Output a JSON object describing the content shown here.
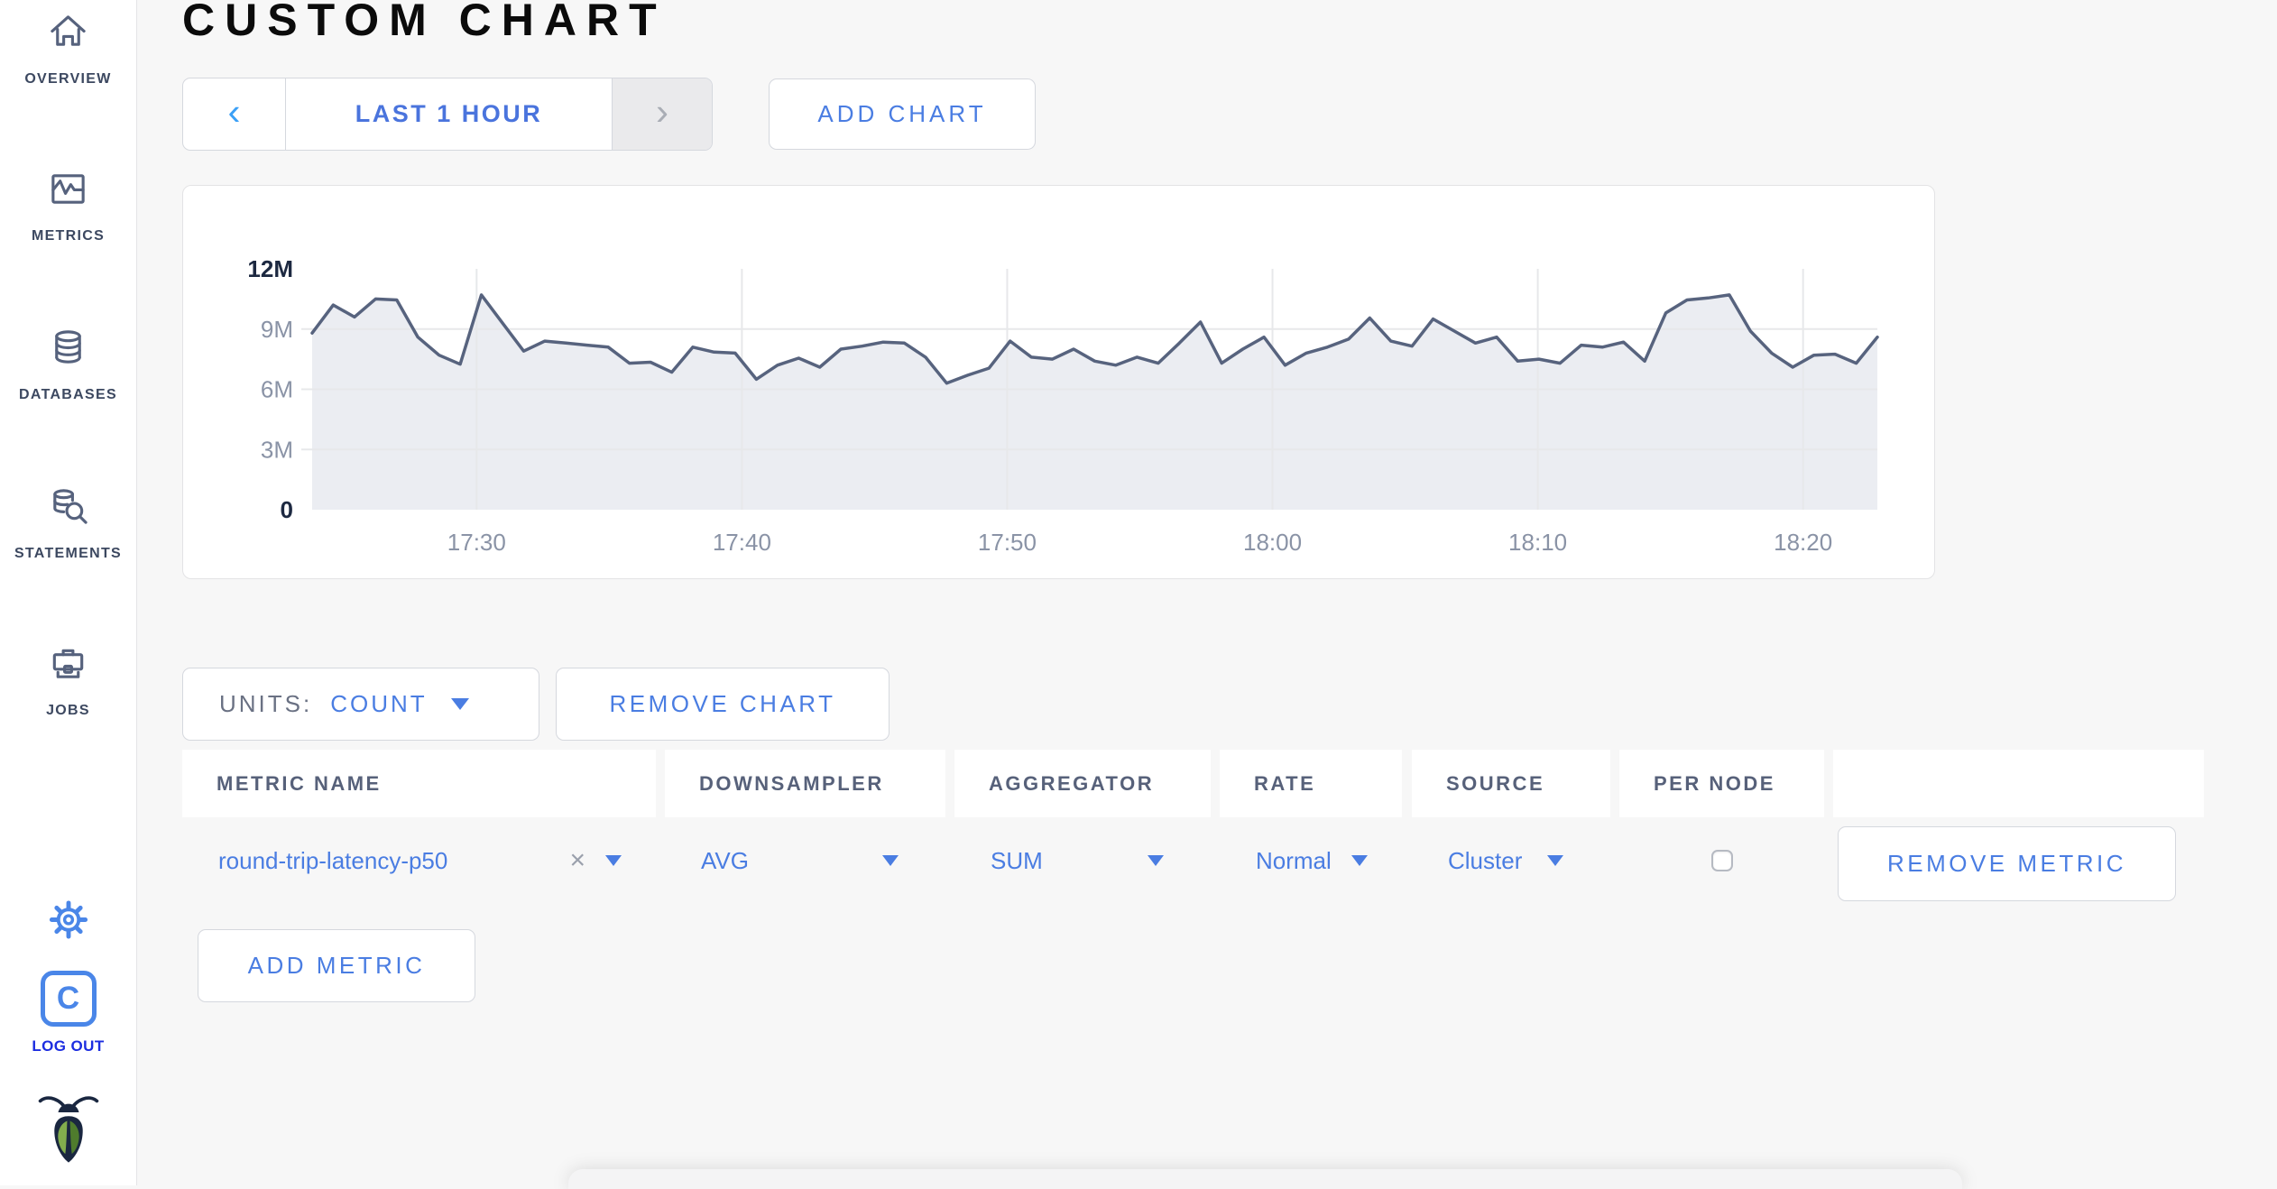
{
  "page": {
    "title": "CUSTOM CHART"
  },
  "sidebar": {
    "items": [
      {
        "label": "OVERVIEW"
      },
      {
        "label": "METRICS"
      },
      {
        "label": "DATABASES"
      },
      {
        "label": "STATEMENTS"
      },
      {
        "label": "JOBS"
      }
    ],
    "logo_letter": "C",
    "logout_label": "LOG OUT"
  },
  "toolbar": {
    "prev": "‹",
    "range_label": "LAST 1 HOUR",
    "next": "›",
    "add_chart": "ADD CHART"
  },
  "chart_controls": {
    "units_label": "UNITS:",
    "units_value": "COUNT",
    "remove_chart": "REMOVE CHART",
    "add_metric": "ADD METRIC"
  },
  "metrics_table": {
    "headers": [
      "METRIC NAME",
      "DOWNSAMPLER",
      "AGGREGATOR",
      "RATE",
      "SOURCE",
      "PER NODE",
      ""
    ],
    "row": {
      "metric_name": "round-trip-latency-p50",
      "clear": "×",
      "downsampler": "AVG",
      "aggregator": "SUM",
      "rate": "Normal",
      "source": "Cluster",
      "per_node_checked": false,
      "remove_metric": "REMOVE METRIC"
    }
  },
  "colors": {
    "accent_blue": "#4a7de2",
    "logout_blue": "#1c2de0",
    "sidebar_icon_slate": "#56627d",
    "disabled_segment": "#eaeaec",
    "page_background": "#f7f7f7"
  },
  "chart_data": {
    "type": "area",
    "title": "",
    "xlabel": "",
    "ylabel": "count",
    "legend": "none",
    "grid": true,
    "ylim": [
      0,
      12
    ],
    "y_unit": "M",
    "y_ticks": [
      {
        "value": 0,
        "label": "0",
        "emphasis": true
      },
      {
        "value": 3,
        "label": "3M",
        "emphasis": false
      },
      {
        "value": 6,
        "label": "6M",
        "emphasis": false
      },
      {
        "value": 9,
        "label": "9M",
        "emphasis": false
      },
      {
        "value": 12,
        "label": "12M",
        "emphasis": true
      }
    ],
    "grid_y_values": [
      3,
      6,
      9
    ],
    "x_range_min": [
      0,
      59
    ],
    "x_ticks": [
      {
        "min": 6.2,
        "label": "17:30"
      },
      {
        "min": 16.2,
        "label": "17:40"
      },
      {
        "min": 26.2,
        "label": "17:50"
      },
      {
        "min": 36.2,
        "label": "18:00"
      },
      {
        "min": 46.2,
        "label": "18:10"
      },
      {
        "min": 56.2,
        "label": "18:20"
      }
    ],
    "series": [
      {
        "name": "round-trip-latency-p50",
        "unit_scale": 1000000,
        "values_millions": [
          8.8,
          10.2,
          9.6,
          10.5,
          10.45,
          8.6,
          7.7,
          7.25,
          10.7,
          9.3,
          7.9,
          8.4,
          8.3,
          8.2,
          8.1,
          7.3,
          7.35,
          6.85,
          8.1,
          7.85,
          7.8,
          6.5,
          7.2,
          7.55,
          7.1,
          8.0,
          8.15,
          8.35,
          8.3,
          7.6,
          6.3,
          6.7,
          7.05,
          8.4,
          7.6,
          7.5,
          8.0,
          7.4,
          7.2,
          7.6,
          7.3,
          8.3,
          9.35,
          7.3,
          8.0,
          8.6,
          7.2,
          7.8,
          8.1,
          8.5,
          9.55,
          8.4,
          8.15,
          9.5,
          8.9,
          8.3,
          8.6,
          7.4,
          7.5,
          7.3,
          8.2,
          8.1,
          8.35,
          7.4,
          9.8,
          10.45,
          10.55,
          10.7,
          8.9,
          7.8,
          7.1,
          7.7,
          7.75,
          7.3,
          8.6
        ]
      }
    ],
    "line_color": "#57637e",
    "fill_color": "#e9ebf1",
    "grid_color": "#e7e8ea",
    "tick_color": "#8a93a6",
    "tick_color_emphasis": "#1d2941"
  }
}
